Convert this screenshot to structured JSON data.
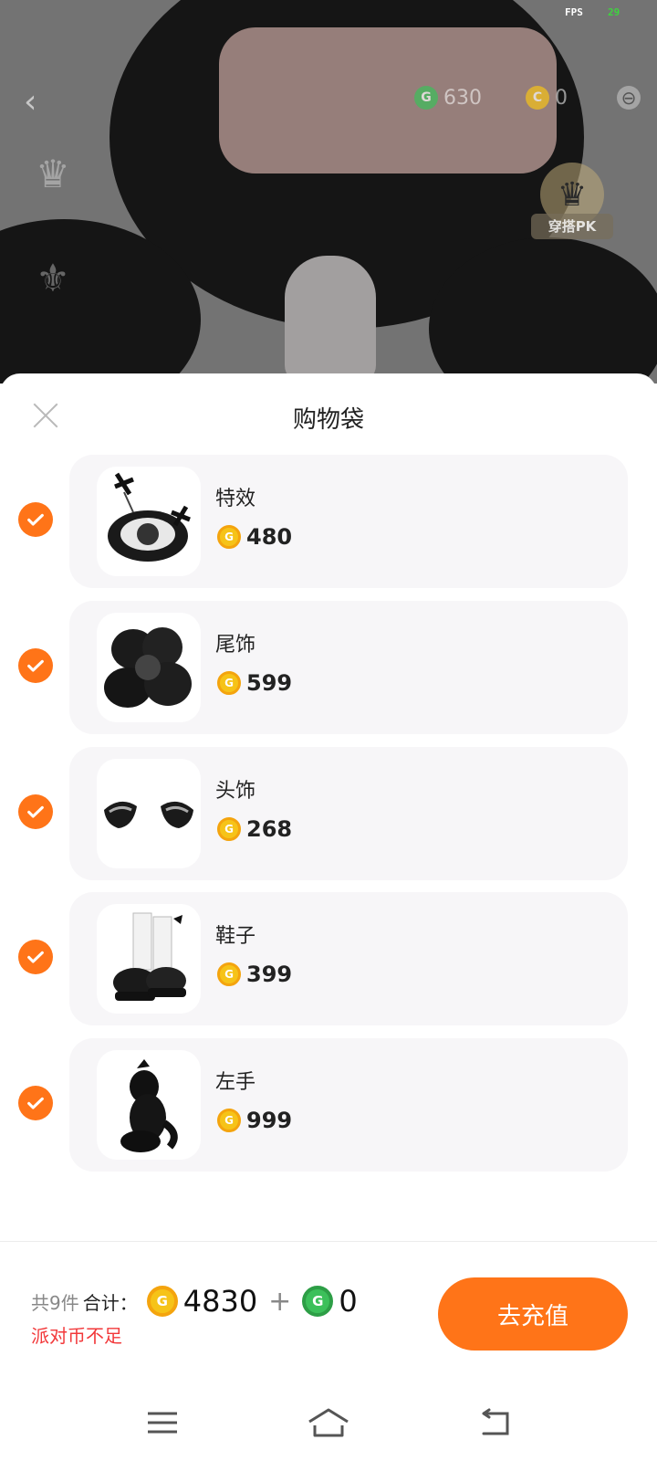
{
  "status": {
    "fps_label": "FPS",
    "fps_value": "29"
  },
  "header": {
    "back_icon": "chevron-left-icon",
    "coins": [
      {
        "icon": "g-coin-icon",
        "value": "630",
        "color": "#3cc05a"
      },
      {
        "icon": "c-coin-icon",
        "value": "0",
        "color": "#f6c318"
      }
    ],
    "pk_badge_label": "穿搭PK"
  },
  "sheet": {
    "title": "购物袋",
    "close_icon": "close-icon",
    "items": [
      {
        "name": "特效",
        "price": "480",
        "checked": true
      },
      {
        "name": "尾饰",
        "price": "599",
        "checked": true
      },
      {
        "name": "头饰",
        "price": "268",
        "checked": true
      },
      {
        "name": "鞋子",
        "price": "399",
        "checked": true
      },
      {
        "name": "左手",
        "price": "999",
        "checked": true
      }
    ]
  },
  "footer": {
    "count_label": "共9件",
    "sum_label": "合计：",
    "gold_total": "4830",
    "plus": "+",
    "green_total": "0",
    "warning": "派对币不足",
    "recharge_label": "去充值"
  },
  "nav": {
    "menu_icon": "menu-icon",
    "home_icon": "home-icon",
    "back_icon": "back-icon"
  },
  "colors": {
    "accent": "#ff7418",
    "warning": "#f2383a",
    "gold": "#f6c318",
    "green": "#3cc05a"
  }
}
